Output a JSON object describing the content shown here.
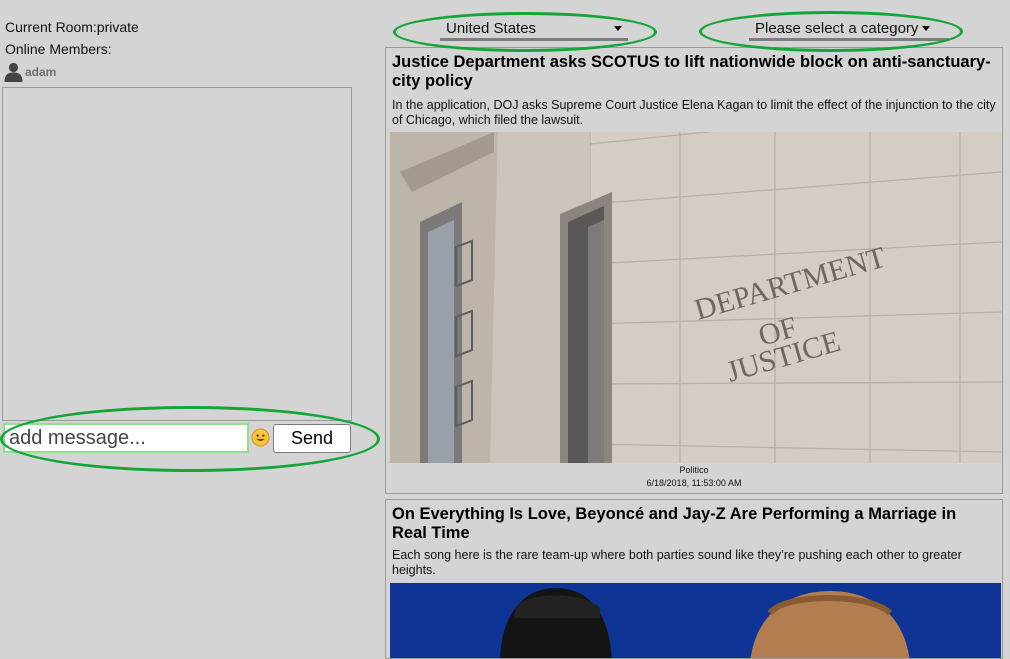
{
  "chat": {
    "current_room": "Current Room:private",
    "online_members_label": "Online Members:",
    "members": [
      {
        "name": "adam"
      }
    ],
    "message_placeholder": "add message...",
    "emoji_icon": "smiley-emoji-icon",
    "send_label": "Send"
  },
  "filters": {
    "country": "United States",
    "category": "Please select a category"
  },
  "articles": [
    {
      "title": "Justice Department asks SCOTUS to lift nationwide block on anti-sanctuary-city policy",
      "description": "In the application, DOJ asks Supreme Court Justice Elena Kagan to limit the effect of the injunction to the city of Chicago, which filed the lawsuit.",
      "image_text": "DEPARTMENT OF JUSTICE",
      "source": "Politico",
      "date": "6/18/2018, 11:53:00 AM"
    },
    {
      "title": "On Everything Is Love, Beyoncé and Jay-Z Are Performing a Marriage in Real Time",
      "description": "Each song here is the rare team-up where both parties sound like they’re pushing each other to greater heights."
    }
  ],
  "colors": {
    "background": "#d4d4d4",
    "highlight_ring": "#13a538",
    "input_border": "#8fe08a"
  }
}
